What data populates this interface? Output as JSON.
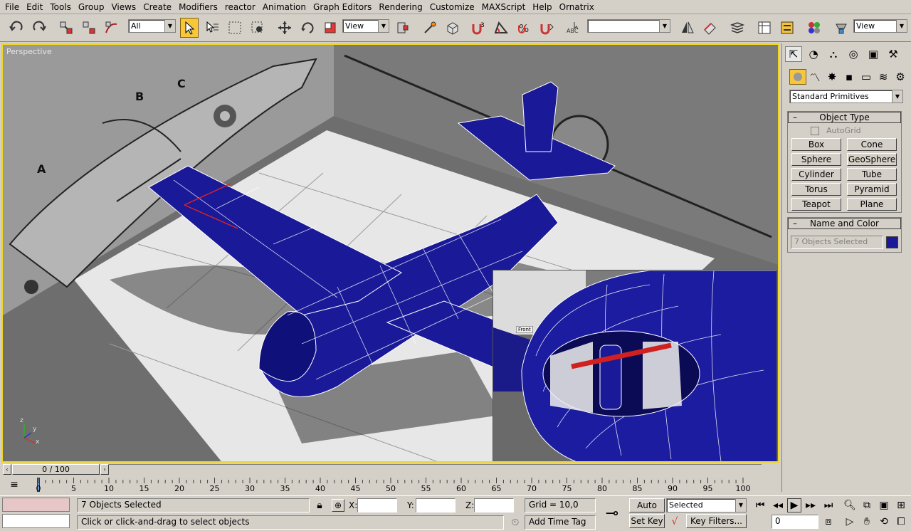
{
  "menu": [
    "File",
    "Edit",
    "Tools",
    "Group",
    "Views",
    "Create",
    "Modifiers",
    "reactor",
    "Animation",
    "Graph Editors",
    "Rendering",
    "Customize",
    "MAXScript",
    "Help",
    "Ornatrix"
  ],
  "toolbar": {
    "selection_filter": "All",
    "ref_coord_1": "View",
    "named_sel": "",
    "ref_coord_2": "View"
  },
  "viewport": {
    "label": "Perspective",
    "inset_label": "Front",
    "axis": {
      "x": "x",
      "y": "y",
      "z": "z"
    }
  },
  "command_panel": {
    "category": "Standard Primitives",
    "object_type_title": "Object Type",
    "autogrid": "AutoGrid",
    "buttons": [
      "Box",
      "Cone",
      "Sphere",
      "GeoSphere",
      "Cylinder",
      "Tube",
      "Torus",
      "Pyramid",
      "Teapot",
      "Plane"
    ],
    "name_color_title": "Name and Color",
    "name_field": "7 Objects Selected",
    "object_color": "#1a1a99"
  },
  "timeslider": {
    "frame": "0 / 100"
  },
  "timeline": {
    "ticks": [
      "0",
      "5",
      "10",
      "15",
      "20",
      "25",
      "30",
      "35",
      "40",
      "45",
      "50",
      "55",
      "60",
      "65",
      "70",
      "75",
      "80",
      "85",
      "90",
      "95",
      "100"
    ]
  },
  "status": {
    "selection": "7 Objects Selected",
    "prompt": "Click or click-and-drag to select objects",
    "x_label": "X:",
    "y_label": "Y:",
    "z_label": "Z:",
    "grid": "Grid = 10,0",
    "add_time_tag": "Add Time Tag",
    "auto_key": "Auto Key",
    "set_key": "Set Key",
    "key_mode": "Selected",
    "key_filters": "Key Filters...",
    "frame_field": "0"
  }
}
